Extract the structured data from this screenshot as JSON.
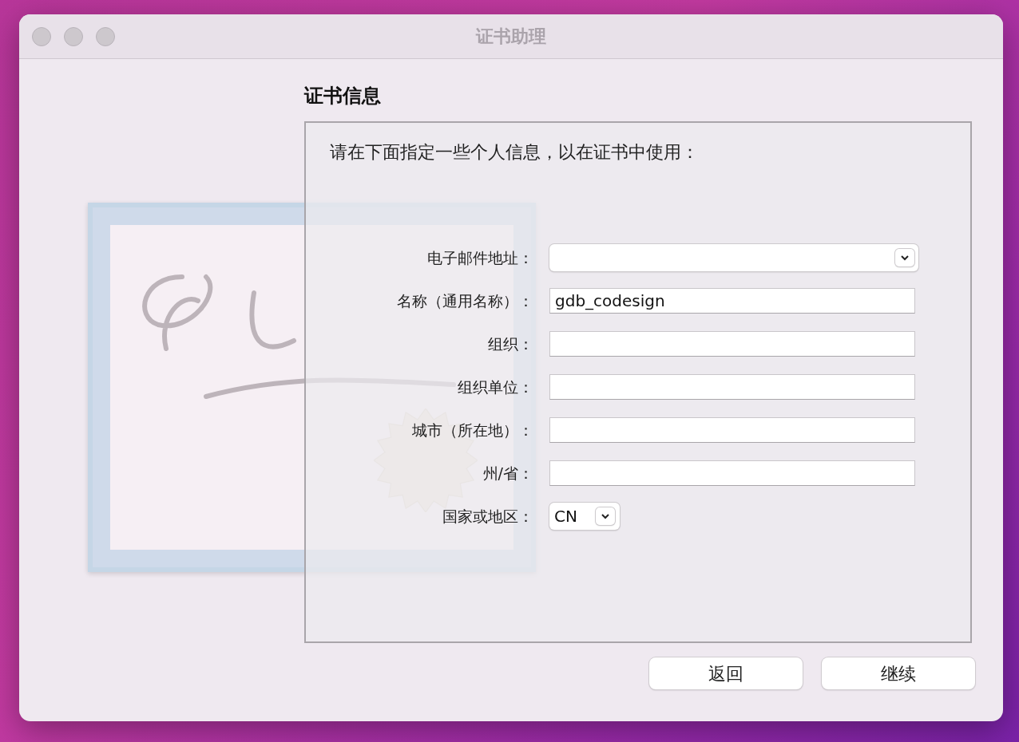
{
  "window": {
    "title": "证书助理"
  },
  "section_title": "证书信息",
  "instruction": "请在下面指定一些个人信息，以在证书中使用：",
  "fields": [
    {
      "label": "电子邮件地址：",
      "kind": "combo"
    },
    {
      "label": "名称（通用名称）：",
      "kind": "text",
      "value": "gdb_codesign"
    },
    {
      "label": "组织：",
      "kind": "text"
    },
    {
      "label": "组织单位：",
      "kind": "text"
    },
    {
      "label": "城市（所在地）：",
      "kind": "text"
    },
    {
      "label": "州/省：",
      "kind": "text"
    },
    {
      "label": "国家或地区：",
      "kind": "popup",
      "value": "CN"
    }
  ],
  "buttons": [
    {
      "label": "返回"
    },
    {
      "label": "继续"
    }
  ]
}
